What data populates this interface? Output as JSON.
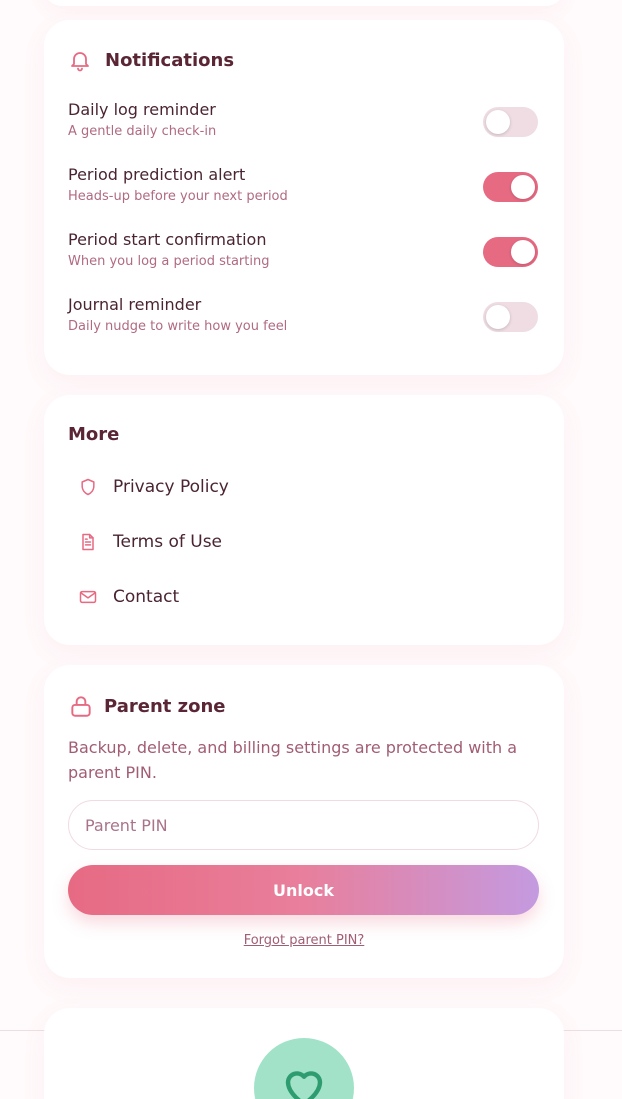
{
  "notifications": {
    "title": "Notifications",
    "items": [
      {
        "title": "Daily log reminder",
        "subtitle": "A gentle daily check-in",
        "enabled": false
      },
      {
        "title": "Period prediction alert",
        "subtitle": "Heads-up before your next period",
        "enabled": true
      },
      {
        "title": "Period start confirmation",
        "subtitle": "When you log a period starting",
        "enabled": true
      },
      {
        "title": "Journal reminder",
        "subtitle": "Daily nudge to write how you feel",
        "enabled": false
      }
    ]
  },
  "more": {
    "title": "More",
    "links": [
      {
        "label": "Privacy Policy",
        "icon": "shield-icon"
      },
      {
        "label": "Terms of Use",
        "icon": "document-icon"
      },
      {
        "label": "Contact",
        "icon": "mail-icon"
      }
    ]
  },
  "parent_zone": {
    "title": "Parent zone",
    "description": "Backup, delete, and billing settings are protected with a parent PIN.",
    "pin_placeholder": "Parent PIN",
    "pin_value": "",
    "unlock_label": "Unlock",
    "forgot_label": "Forgot parent PIN?"
  },
  "colors": {
    "accent": "#e76a83",
    "accent_gradient_end": "#c49ae0",
    "toggle_off": "#efdde3",
    "heart_bg": "#a2e2c9",
    "heart_stroke": "#2f9c70"
  }
}
